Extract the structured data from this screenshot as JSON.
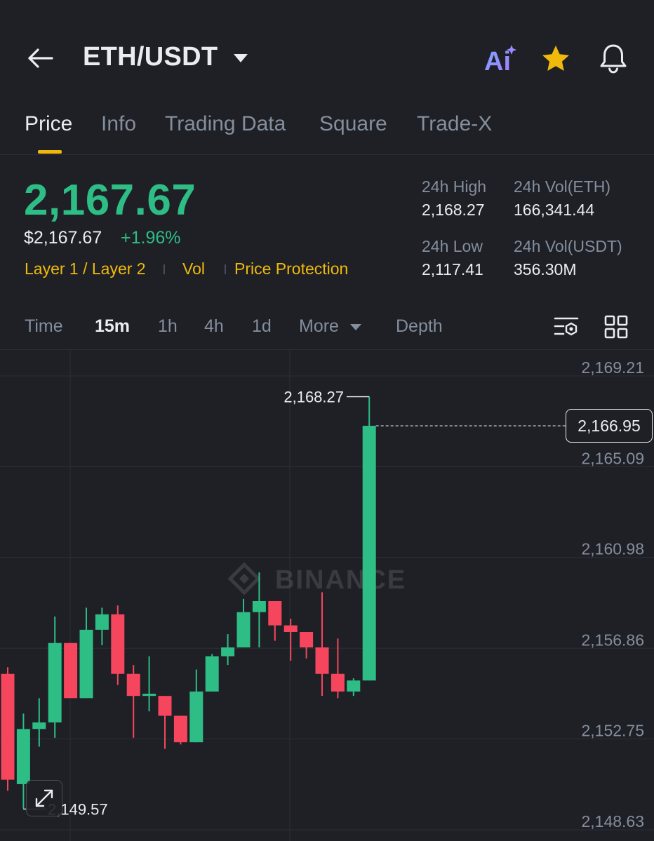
{
  "header": {
    "pair": "ETH/USDT",
    "ai_label": "Ai",
    "icons": [
      "back-arrow-icon",
      "caret-down-icon",
      "ai-icon",
      "star-icon",
      "bell-icon"
    ]
  },
  "tabs": [
    {
      "label": "Price",
      "active": true
    },
    {
      "label": "Info",
      "active": false
    },
    {
      "label": "Trading Data",
      "active": false
    },
    {
      "label": "Square",
      "active": false
    },
    {
      "label": "Trade-X",
      "active": false
    }
  ],
  "price": {
    "last": "2,167.67",
    "usd": "$2,167.67",
    "change": "+1.96%",
    "tags": [
      "Layer 1 / Layer 2",
      "Vol",
      "Price Protection"
    ]
  },
  "stats": {
    "high_label": "24h High",
    "high_value": "2,168.27",
    "low_label": "24h Low",
    "low_value": "2,117.41",
    "vol_eth_label": "24h Vol(ETH)",
    "vol_eth_value": "166,341.44",
    "vol_usdt_label": "24h Vol(USDT)",
    "vol_usdt_value": "356.30M"
  },
  "intervals": {
    "time": "Time",
    "m15": "15m",
    "h1": "1h",
    "h4": "4h",
    "d1": "1d",
    "more": "More",
    "depth": "Depth",
    "active": "15m"
  },
  "colors": {
    "up": "#2ebd85",
    "down": "#f6465d",
    "accent": "#f0b90b",
    "bg": "#1e2026"
  },
  "chart": {
    "watermark": "BINANCE",
    "current_price_tag": "2,166.95",
    "high_marker": "2,168.27",
    "low_marker": "2,149.57"
  },
  "chart_data": {
    "type": "candlestick",
    "y_ticks": [
      "2,169.21",
      "2,165.09",
      "2,160.98",
      "2,156.86",
      "2,152.75",
      "2,148.63"
    ],
    "y_tick_values": [
      2169.21,
      2165.09,
      2160.98,
      2156.86,
      2152.75,
      2148.63
    ],
    "ylim": [
      2148.63,
      2169.21
    ],
    "current_price": 2166.95,
    "high_marker_value": 2168.27,
    "low_marker_value": 2149.57,
    "candles": [
      {
        "o": 2155.7,
        "h": 2156.0,
        "l": 2150.4,
        "c": 2150.9
      },
      {
        "o": 2150.7,
        "h": 2153.9,
        "l": 2149.6,
        "c": 2153.2
      },
      {
        "o": 2153.2,
        "h": 2154.6,
        "l": 2152.4,
        "c": 2153.5
      },
      {
        "o": 2153.5,
        "h": 2158.3,
        "l": 2152.8,
        "c": 2157.1
      },
      {
        "o": 2157.1,
        "h": 2157.1,
        "l": 2154.7,
        "c": 2154.6
      },
      {
        "o": 2154.6,
        "h": 2158.7,
        "l": 2154.6,
        "c": 2157.7
      },
      {
        "o": 2157.7,
        "h": 2158.7,
        "l": 2157.0,
        "c": 2158.4
      },
      {
        "o": 2158.4,
        "h": 2158.8,
        "l": 2155.2,
        "c": 2155.7
      },
      {
        "o": 2155.7,
        "h": 2156.1,
        "l": 2152.8,
        "c": 2154.7
      },
      {
        "o": 2154.7,
        "h": 2156.5,
        "l": 2154.0,
        "c": 2154.8
      },
      {
        "o": 2154.7,
        "h": 2154.7,
        "l": 2152.3,
        "c": 2153.8
      },
      {
        "o": 2153.8,
        "h": 2153.8,
        "l": 2152.5,
        "c": 2152.6
      },
      {
        "o": 2152.6,
        "h": 2155.9,
        "l": 2152.6,
        "c": 2154.9
      },
      {
        "o": 2154.9,
        "h": 2156.6,
        "l": 2154.9,
        "c": 2156.5
      },
      {
        "o": 2156.5,
        "h": 2157.5,
        "l": 2156.1,
        "c": 2156.9
      },
      {
        "o": 2156.9,
        "h": 2159.1,
        "l": 2156.9,
        "c": 2158.5
      },
      {
        "o": 2158.5,
        "h": 2160.3,
        "l": 2156.9,
        "c": 2159.0
      },
      {
        "o": 2159.0,
        "h": 2159.0,
        "l": 2157.2,
        "c": 2157.9
      },
      {
        "o": 2157.9,
        "h": 2158.2,
        "l": 2156.3,
        "c": 2157.6
      },
      {
        "o": 2157.6,
        "h": 2157.6,
        "l": 2156.4,
        "c": 2156.9
      },
      {
        "o": 2156.9,
        "h": 2159.4,
        "l": 2154.7,
        "c": 2155.7
      },
      {
        "o": 2155.7,
        "h": 2157.3,
        "l": 2154.6,
        "c": 2154.9
      },
      {
        "o": 2154.9,
        "h": 2155.5,
        "l": 2154.7,
        "c": 2155.4
      },
      {
        "o": 2155.4,
        "h": 2168.27,
        "l": 2155.4,
        "c": 2166.95
      }
    ]
  }
}
